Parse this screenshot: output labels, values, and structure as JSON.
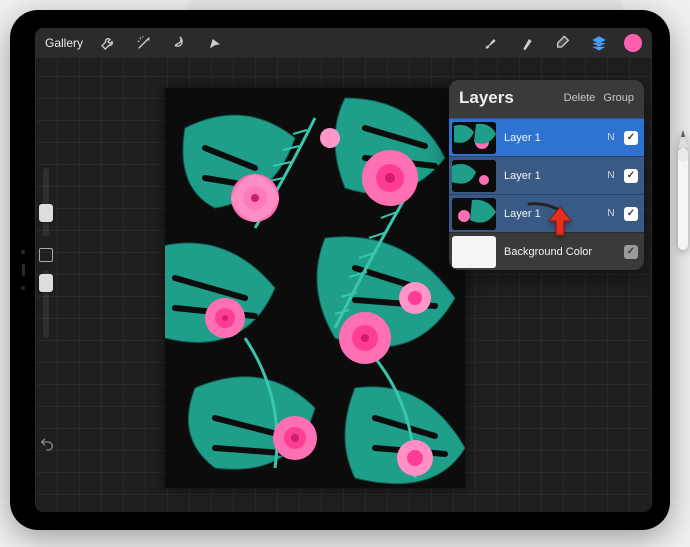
{
  "topbar": {
    "gallery_label": "Gallery"
  },
  "layers_panel": {
    "title": "Layers",
    "delete_label": "Delete",
    "group_label": "Group",
    "blend_label": "N",
    "rows": [
      {
        "name": "Layer 1"
      },
      {
        "name": "Layer 1"
      },
      {
        "name": "Layer 1"
      },
      {
        "name": "Background Color"
      }
    ]
  },
  "colors": {
    "accent": "#4a9eff",
    "swatch": "#ff5fae",
    "pointer": "#e53020"
  }
}
